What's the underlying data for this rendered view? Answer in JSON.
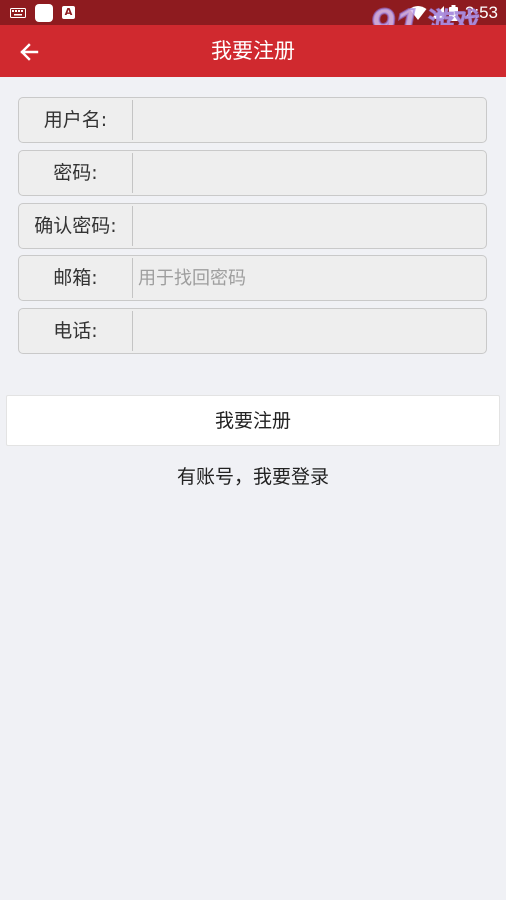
{
  "status_bar": {
    "time": "2:53",
    "icons": [
      "keyboard-icon",
      "app-notification-icon",
      "app-a-icon",
      "wifi-icon",
      "signal-icon",
      "battery-icon"
    ],
    "background": "#8e1b1f"
  },
  "watermark": {
    "number": "91",
    "brand": "游戏",
    "url": "91danji.com"
  },
  "app_bar": {
    "title": "我要注册",
    "back_icon": "arrow-left-icon",
    "background": "#d0292f"
  },
  "form": {
    "fields": [
      {
        "label": "用户名:",
        "value": "",
        "placeholder": ""
      },
      {
        "label": "密码:",
        "value": "",
        "placeholder": ""
      },
      {
        "label": "确认密码:",
        "value": "",
        "placeholder": ""
      },
      {
        "label": "邮箱:",
        "value": "",
        "placeholder": "用于找回密码"
      },
      {
        "label": "电话:",
        "value": "",
        "placeholder": ""
      }
    ]
  },
  "actions": {
    "register_label": "我要注册",
    "login_link": "有账号，我要登录"
  }
}
